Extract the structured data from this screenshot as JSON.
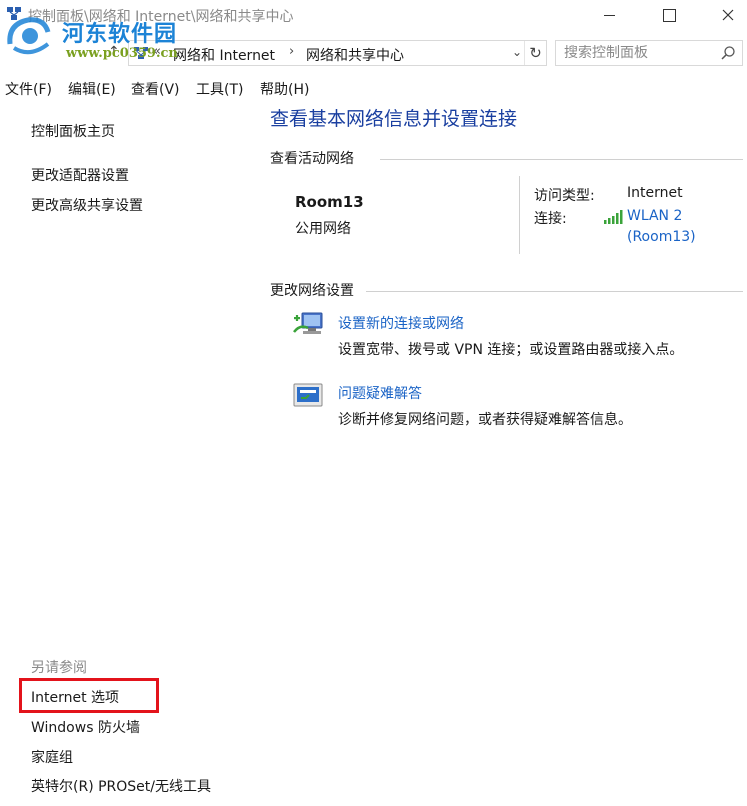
{
  "window": {
    "title": "控制面板\\网络和 Internet\\网络和共享中心",
    "icon": "network-center-icon"
  },
  "watermark": {
    "line1": "河东软件园",
    "line2": "www.pc0359.cn"
  },
  "address": {
    "crumb1": "网络和 Internet",
    "crumb2": "网络和共享中心"
  },
  "search": {
    "placeholder": "搜索控制面板"
  },
  "menu": {
    "file": "文件(F)",
    "edit": "编辑(E)",
    "view": "查看(V)",
    "tools": "工具(T)",
    "help": "帮助(H)"
  },
  "sidebar": {
    "home": "控制面板主页",
    "adapter": "更改适配器设置",
    "sharing": "更改高级共享设置",
    "see_also": "另请参阅",
    "internet_options": "Internet 选项",
    "firewall": "Windows 防火墙",
    "homegroup": "家庭组",
    "intel_tools": "英特尔(R) PROSet/无线工具"
  },
  "main": {
    "title": "查看基本网络信息并设置连接",
    "active_header": "查看活动网络",
    "network_name": "Room13",
    "network_type": "公用网络",
    "access_label": "访问类型:",
    "access_value": "Internet",
    "connection_label": "连接:",
    "connection_name": "WLAN 2",
    "connection_ssid": "(Room13)",
    "change_header": "更改网络设置",
    "tasks": [
      {
        "title": "设置新的连接或网络",
        "desc": "设置宽带、拨号或 VPN 连接；或设置路由器或接入点。"
      },
      {
        "title": "问题疑难解答",
        "desc": "诊断并修复网络问题，或者获得疑难解答信息。"
      }
    ]
  },
  "colors": {
    "link": "#1a63c6",
    "title": "#1a3fa0",
    "highlight": "#e3131b",
    "watermark": "#1c83d6"
  }
}
